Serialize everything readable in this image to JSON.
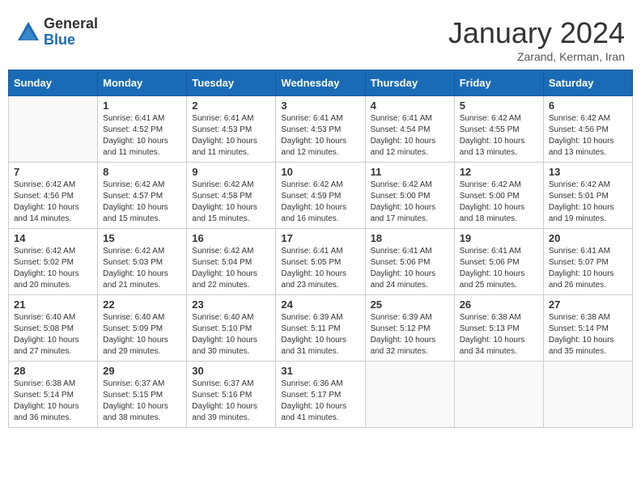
{
  "logo": {
    "general": "General",
    "blue": "Blue"
  },
  "title": "January 2024",
  "subtitle": "Zarand, Kerman, Iran",
  "days_header": [
    "Sunday",
    "Monday",
    "Tuesday",
    "Wednesday",
    "Thursday",
    "Friday",
    "Saturday"
  ],
  "weeks": [
    [
      {
        "day": "",
        "info": ""
      },
      {
        "day": "1",
        "info": "Sunrise: 6:41 AM\nSunset: 4:52 PM\nDaylight: 10 hours\nand 11 minutes."
      },
      {
        "day": "2",
        "info": "Sunrise: 6:41 AM\nSunset: 4:53 PM\nDaylight: 10 hours\nand 11 minutes."
      },
      {
        "day": "3",
        "info": "Sunrise: 6:41 AM\nSunset: 4:53 PM\nDaylight: 10 hours\nand 12 minutes."
      },
      {
        "day": "4",
        "info": "Sunrise: 6:41 AM\nSunset: 4:54 PM\nDaylight: 10 hours\nand 12 minutes."
      },
      {
        "day": "5",
        "info": "Sunrise: 6:42 AM\nSunset: 4:55 PM\nDaylight: 10 hours\nand 13 minutes."
      },
      {
        "day": "6",
        "info": "Sunrise: 6:42 AM\nSunset: 4:56 PM\nDaylight: 10 hours\nand 13 minutes."
      }
    ],
    [
      {
        "day": "7",
        "info": "Sunrise: 6:42 AM\nSunset: 4:56 PM\nDaylight: 10 hours\nand 14 minutes."
      },
      {
        "day": "8",
        "info": "Sunrise: 6:42 AM\nSunset: 4:57 PM\nDaylight: 10 hours\nand 15 minutes."
      },
      {
        "day": "9",
        "info": "Sunrise: 6:42 AM\nSunset: 4:58 PM\nDaylight: 10 hours\nand 15 minutes."
      },
      {
        "day": "10",
        "info": "Sunrise: 6:42 AM\nSunset: 4:59 PM\nDaylight: 10 hours\nand 16 minutes."
      },
      {
        "day": "11",
        "info": "Sunrise: 6:42 AM\nSunset: 5:00 PM\nDaylight: 10 hours\nand 17 minutes."
      },
      {
        "day": "12",
        "info": "Sunrise: 6:42 AM\nSunset: 5:00 PM\nDaylight: 10 hours\nand 18 minutes."
      },
      {
        "day": "13",
        "info": "Sunrise: 6:42 AM\nSunset: 5:01 PM\nDaylight: 10 hours\nand 19 minutes."
      }
    ],
    [
      {
        "day": "14",
        "info": "Sunrise: 6:42 AM\nSunset: 5:02 PM\nDaylight: 10 hours\nand 20 minutes."
      },
      {
        "day": "15",
        "info": "Sunrise: 6:42 AM\nSunset: 5:03 PM\nDaylight: 10 hours\nand 21 minutes."
      },
      {
        "day": "16",
        "info": "Sunrise: 6:42 AM\nSunset: 5:04 PM\nDaylight: 10 hours\nand 22 minutes."
      },
      {
        "day": "17",
        "info": "Sunrise: 6:41 AM\nSunset: 5:05 PM\nDaylight: 10 hours\nand 23 minutes."
      },
      {
        "day": "18",
        "info": "Sunrise: 6:41 AM\nSunset: 5:06 PM\nDaylight: 10 hours\nand 24 minutes."
      },
      {
        "day": "19",
        "info": "Sunrise: 6:41 AM\nSunset: 5:06 PM\nDaylight: 10 hours\nand 25 minutes."
      },
      {
        "day": "20",
        "info": "Sunrise: 6:41 AM\nSunset: 5:07 PM\nDaylight: 10 hours\nand 26 minutes."
      }
    ],
    [
      {
        "day": "21",
        "info": "Sunrise: 6:40 AM\nSunset: 5:08 PM\nDaylight: 10 hours\nand 27 minutes."
      },
      {
        "day": "22",
        "info": "Sunrise: 6:40 AM\nSunset: 5:09 PM\nDaylight: 10 hours\nand 29 minutes."
      },
      {
        "day": "23",
        "info": "Sunrise: 6:40 AM\nSunset: 5:10 PM\nDaylight: 10 hours\nand 30 minutes."
      },
      {
        "day": "24",
        "info": "Sunrise: 6:39 AM\nSunset: 5:11 PM\nDaylight: 10 hours\nand 31 minutes."
      },
      {
        "day": "25",
        "info": "Sunrise: 6:39 AM\nSunset: 5:12 PM\nDaylight: 10 hours\nand 32 minutes."
      },
      {
        "day": "26",
        "info": "Sunrise: 6:38 AM\nSunset: 5:13 PM\nDaylight: 10 hours\nand 34 minutes."
      },
      {
        "day": "27",
        "info": "Sunrise: 6:38 AM\nSunset: 5:14 PM\nDaylight: 10 hours\nand 35 minutes."
      }
    ],
    [
      {
        "day": "28",
        "info": "Sunrise: 6:38 AM\nSunset: 5:14 PM\nDaylight: 10 hours\nand 36 minutes."
      },
      {
        "day": "29",
        "info": "Sunrise: 6:37 AM\nSunset: 5:15 PM\nDaylight: 10 hours\nand 38 minutes."
      },
      {
        "day": "30",
        "info": "Sunrise: 6:37 AM\nSunset: 5:16 PM\nDaylight: 10 hours\nand 39 minutes."
      },
      {
        "day": "31",
        "info": "Sunrise: 6:36 AM\nSunset: 5:17 PM\nDaylight: 10 hours\nand 41 minutes."
      },
      {
        "day": "",
        "info": ""
      },
      {
        "day": "",
        "info": ""
      },
      {
        "day": "",
        "info": ""
      }
    ]
  ]
}
